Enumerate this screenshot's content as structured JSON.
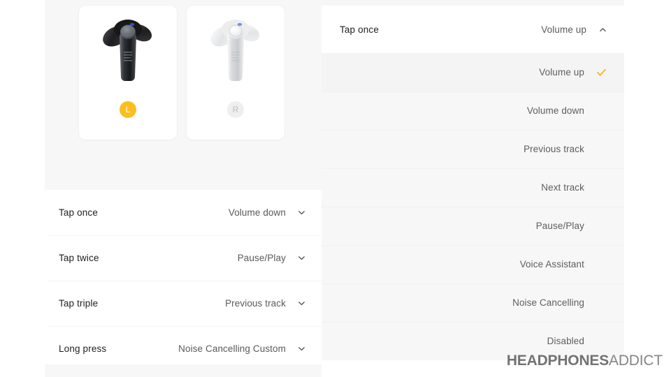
{
  "left_panel": {
    "earbuds": [
      {
        "id": "left-earbud",
        "badge": "L",
        "active": true,
        "color": "#fcbf1e",
        "art": "black-earbud"
      },
      {
        "id": "right-earbud",
        "badge": "R",
        "active": false,
        "color": "#efefef",
        "art": "white-earbud"
      }
    ],
    "rows": [
      {
        "label": "Tap once",
        "value": "Volume down",
        "icon": "chevron-down-icon"
      },
      {
        "label": "Tap twice",
        "value": "Pause/Play",
        "icon": "chevron-down-icon"
      },
      {
        "label": "Tap triple",
        "value": "Previous track",
        "icon": "chevron-down-icon"
      },
      {
        "label": "Long press",
        "value": "Noise Cancelling Custom",
        "icon": "chevron-down-icon"
      }
    ]
  },
  "right_panel": {
    "header": {
      "label": "Tap once",
      "value": "Volume up",
      "icon": "chevron-up-icon"
    },
    "options": [
      {
        "label": "Volume up",
        "selected": true
      },
      {
        "label": "Volume down",
        "selected": false
      },
      {
        "label": "Previous track",
        "selected": false
      },
      {
        "label": "Next track",
        "selected": false
      },
      {
        "label": "Pause/Play",
        "selected": false
      },
      {
        "label": "Voice Assistant",
        "selected": false
      },
      {
        "label": "Noise Cancelling",
        "selected": false
      },
      {
        "label": "Disabled",
        "selected": false
      }
    ],
    "check_icon": "check-icon",
    "accent_color": "#f5b314"
  },
  "watermark": {
    "bold": "HEADPHONES",
    "light": "ADDICT"
  }
}
